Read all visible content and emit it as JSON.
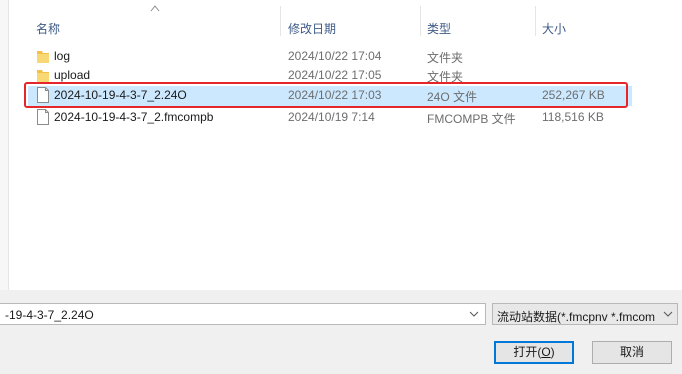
{
  "columns": {
    "name": "名称",
    "date": "修改日期",
    "type": "类型",
    "size": "大小"
  },
  "files": [
    {
      "name": "log",
      "date": "2024/10/22 17:04",
      "type": "文件夹",
      "size": "",
      "icon": "folder-icon"
    },
    {
      "name": "upload",
      "date": "2024/10/22 17:05",
      "type": "文件夹",
      "size": "",
      "icon": "folder-icon"
    },
    {
      "name": "2024-10-19-4-3-7_2.24O",
      "date": "2024/10/22 17:03",
      "type": "24O 文件",
      "size": "252,267 KB",
      "icon": "file-icon",
      "selected": true
    },
    {
      "name": "2024-10-19-4-3-7_2.fmcompb",
      "date": "2024/10/19 7:14",
      "type": "FMCOMPB 文件",
      "size": "118,516 KB",
      "icon": "file-icon"
    }
  ],
  "filename_input": {
    "value": "-19-4-3-7_2.24O"
  },
  "filter": {
    "value": "流动站数据(*.fmcpnv *.fmcom"
  },
  "buttons": {
    "open": "打开(",
    "open_key": "O",
    "open_end": ")",
    "cancel": "取消"
  },
  "colors": {
    "selection": "#cce8ff",
    "highlight_border": "#e5262b",
    "folder": "#f3c149"
  }
}
